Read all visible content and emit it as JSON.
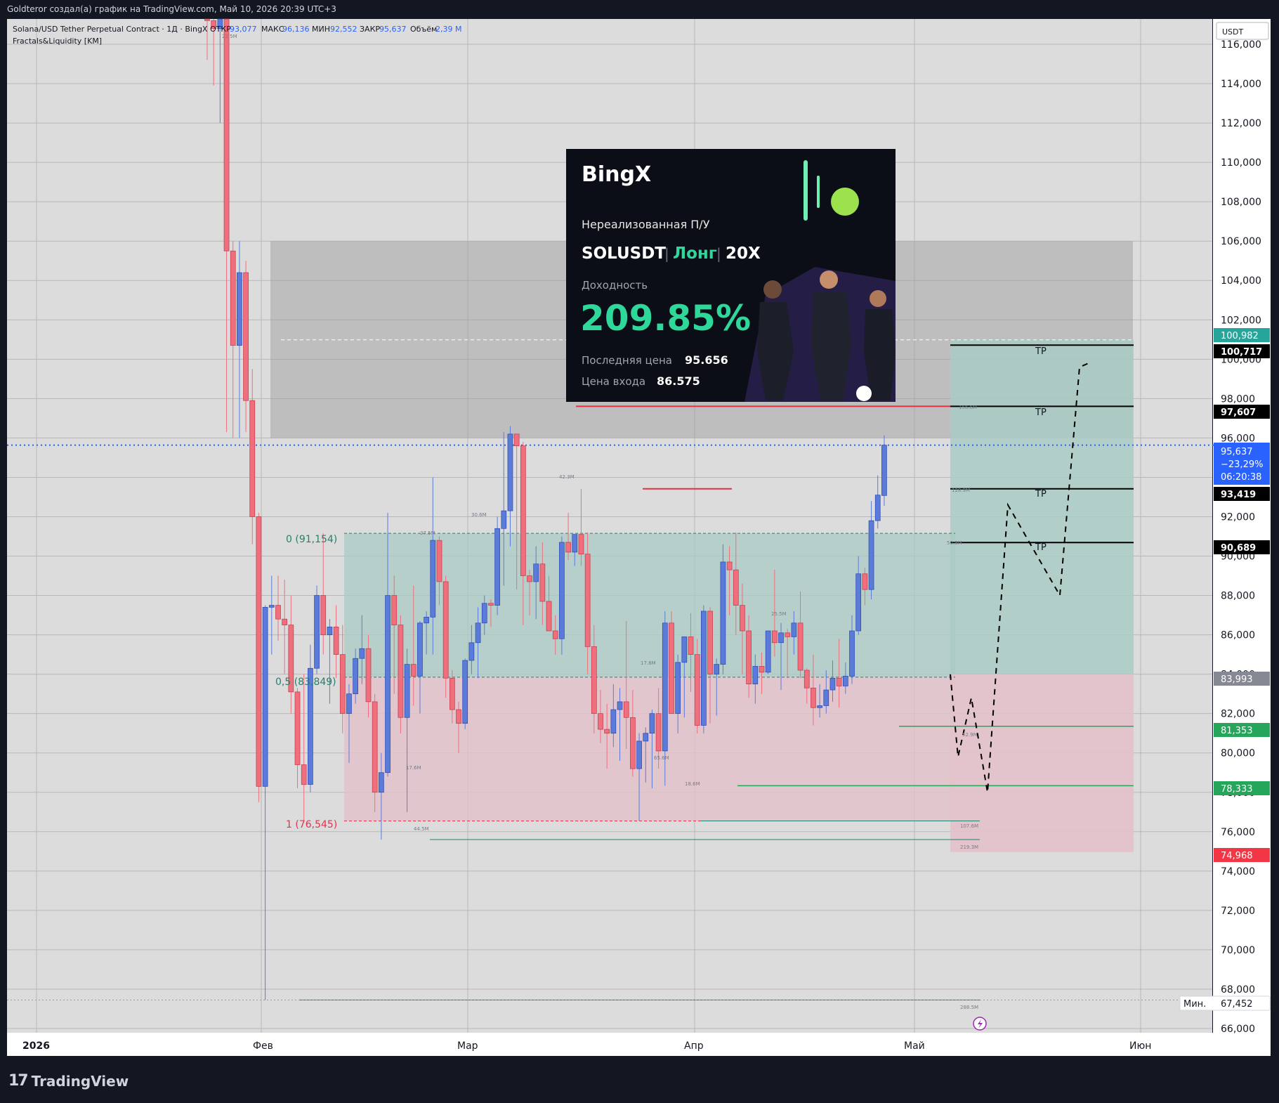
{
  "header_credit": "Goldteror создал(а) график на TradingView.com, Май 10, 2026 20:39 UTC+3",
  "brand": "TradingView",
  "legend": {
    "symbol": "Solana/USD Tether Perpetual Contract · 1Д · BingX",
    "open_label": "ОТКР",
    "open_value": "93,077",
    "high_label": "МАКС",
    "high_value": "96,136",
    "low_label": "МИН",
    "low_value": "92,552",
    "close_label": "ЗАКР",
    "close_value": "95,637",
    "volume_label": "Объём",
    "volume_value": "2,39 M",
    "indicator": "Fractals&Liquidity [KM]"
  },
  "currency": "USDT",
  "time_labels": {
    "year": "2026",
    "feb": "Фев",
    "mar": "Мар",
    "apr": "Апр",
    "may": "Май",
    "jun": "Июн"
  },
  "price_labels": {
    "p1": "100,982",
    "p2": "100,717",
    "p3": "97,607",
    "p4_price": "95,637",
    "p4_change": "−23,29%",
    "p4_timer": "06:20:38",
    "p5": "93,419",
    "p6": "90,689",
    "p7": "83,993",
    "p8": "81,353",
    "p9": "78,333",
    "p10": "74,968",
    "min_label": "Мин.",
    "min_value": "67,452"
  },
  "fib": {
    "level0": "0 (91,154)",
    "level05": "0,5 (83,849)",
    "level1": "1 (76,545)"
  },
  "tp_label": "TP",
  "volume_tags": [
    "22.5M",
    "156.6M",
    "128.9M",
    "50.9M",
    "42.3M",
    "30.6M",
    "37.5M",
    "25.5M",
    "17.8M",
    "17.6M",
    "65.6M",
    "18.6M",
    "44.5M",
    "107.6M",
    "219.3M",
    "288.5M",
    "52.9M"
  ],
  "promo": {
    "brand": "BingX",
    "subtitle": "Нереализованная П/У",
    "pair": "SOLUSDT",
    "side": "Лонг",
    "leverage": "20X",
    "yield_label": "Доходность",
    "yield_value": "209.85%",
    "last_label": "Последняя цена",
    "last_value": "95.656",
    "entry_label": "Цена входа",
    "entry_value": "86.575"
  },
  "colors": {
    "up": "#5b7bd8",
    "down": "#ef6f7c",
    "bg": "#dcdcdc",
    "accent": "#2962ff",
    "tp_zone": "#a9cbc4",
    "sl_zone": "#e3c1ca"
  },
  "chart_data": {
    "type": "candlestick",
    "ylim": [
      66000,
      117000
    ],
    "y_ticks": [
      66000,
      68000,
      70000,
      72000,
      74000,
      76000,
      78000,
      80000,
      82000,
      84000,
      86000,
      88000,
      90000,
      92000,
      94000,
      96000,
      98000,
      100000,
      102000,
      104000,
      106000,
      108000,
      110000,
      112000,
      114000,
      116000
    ],
    "y_tick_labels": [
      "66,000",
      "68,000",
      "70,000",
      "72,000",
      "74,000",
      "76,000",
      "78,000",
      "80,000",
      "82,000",
      "84,000",
      "86,000",
      "88,000",
      "90,000",
      "92,000",
      "94,000",
      "96,000",
      "98,000",
      "100,000",
      "102,000",
      "104,000",
      "106,000",
      "108,000",
      "110,000",
      "112,000",
      "114,000",
      "116,000"
    ],
    "x_start": "2026-01-27",
    "candles": [
      {
        "o": 117500,
        "h": 118500,
        "l": 115200,
        "c": 117200
      },
      {
        "o": 117200,
        "h": 118000,
        "l": 113900,
        "c": 116800
      },
      {
        "o": 116800,
        "h": 118200,
        "l": 112000,
        "c": 117500
      },
      {
        "o": 117500,
        "h": 117800,
        "l": 96300,
        "c": 105500
      },
      {
        "o": 105500,
        "h": 106000,
        "l": 96000,
        "c": 100700
      },
      {
        "o": 100700,
        "h": 106000,
        "l": 96000,
        "c": 104400
      },
      {
        "o": 104400,
        "h": 105000,
        "l": 96300,
        "c": 97900
      },
      {
        "o": 97900,
        "h": 99500,
        "l": 90600,
        "c": 92000
      },
      {
        "o": 92000,
        "h": 92200,
        "l": 77500,
        "c": 78300
      },
      {
        "o": 78300,
        "h": 87500,
        "l": 67452,
        "c": 87400
      },
      {
        "o": 87400,
        "h": 89000,
        "l": 85000,
        "c": 87500
      },
      {
        "o": 87500,
        "h": 89000,
        "l": 85700,
        "c": 86800
      },
      {
        "o": 86800,
        "h": 88800,
        "l": 84000,
        "c": 86500
      },
      {
        "o": 86500,
        "h": 88000,
        "l": 82000,
        "c": 83100
      },
      {
        "o": 83100,
        "h": 83300,
        "l": 78200,
        "c": 79400
      },
      {
        "o": 79400,
        "h": 84000,
        "l": 76545,
        "c": 78400
      },
      {
        "o": 78400,
        "h": 85500,
        "l": 78000,
        "c": 84300
      },
      {
        "o": 84300,
        "h": 88500,
        "l": 84000,
        "c": 88000
      },
      {
        "o": 88000,
        "h": 91154,
        "l": 85000,
        "c": 86000
      },
      {
        "o": 86000,
        "h": 86800,
        "l": 82500,
        "c": 86400
      },
      {
        "o": 86400,
        "h": 87500,
        "l": 83800,
        "c": 85000
      },
      {
        "o": 85000,
        "h": 86500,
        "l": 81000,
        "c": 82000
      },
      {
        "o": 82000,
        "h": 83500,
        "l": 79500,
        "c": 83000
      },
      {
        "o": 83000,
        "h": 85300,
        "l": 82500,
        "c": 84800
      },
      {
        "o": 84800,
        "h": 87000,
        "l": 83500,
        "c": 85300
      },
      {
        "o": 85300,
        "h": 86000,
        "l": 81800,
        "c": 82600
      },
      {
        "o": 82600,
        "h": 83000,
        "l": 77000,
        "c": 78000
      },
      {
        "o": 78000,
        "h": 80000,
        "l": 75600,
        "c": 79000
      },
      {
        "o": 79000,
        "h": 92200,
        "l": 78800,
        "c": 88000
      },
      {
        "o": 88000,
        "h": 89000,
        "l": 83000,
        "c": 86500
      },
      {
        "o": 86500,
        "h": 87000,
        "l": 81000,
        "c": 81800
      },
      {
        "o": 81800,
        "h": 85300,
        "l": 77000,
        "c": 84500
      },
      {
        "o": 84500,
        "h": 88500,
        "l": 82400,
        "c": 83900
      },
      {
        "o": 83900,
        "h": 86700,
        "l": 82000,
        "c": 86600
      },
      {
        "o": 86600,
        "h": 87200,
        "l": 85000,
        "c": 86900
      },
      {
        "o": 86900,
        "h": 94000,
        "l": 85000,
        "c": 90800
      },
      {
        "o": 90800,
        "h": 91000,
        "l": 87500,
        "c": 88700
      },
      {
        "o": 88700,
        "h": 89000,
        "l": 82800,
        "c": 83800
      },
      {
        "o": 83800,
        "h": 84200,
        "l": 81500,
        "c": 82200
      },
      {
        "o": 82200,
        "h": 82600,
        "l": 80000,
        "c": 81500
      },
      {
        "o": 81500,
        "h": 84800,
        "l": 81200,
        "c": 84700
      },
      {
        "o": 84700,
        "h": 86500,
        "l": 84000,
        "c": 85600
      },
      {
        "o": 85600,
        "h": 87400,
        "l": 83800,
        "c": 86600
      },
      {
        "o": 86600,
        "h": 88000,
        "l": 86000,
        "c": 87600
      },
      {
        "o": 87600,
        "h": 87800,
        "l": 86400,
        "c": 87500
      },
      {
        "o": 87500,
        "h": 92000,
        "l": 87000,
        "c": 91400
      },
      {
        "o": 91400,
        "h": 96300,
        "l": 88500,
        "c": 92300
      },
      {
        "o": 92300,
        "h": 96600,
        "l": 90500,
        "c": 96200
      },
      {
        "o": 96200,
        "h": 95900,
        "l": 88300,
        "c": 95600
      },
      {
        "o": 95600,
        "h": 95800,
        "l": 86500,
        "c": 89000
      },
      {
        "o": 89000,
        "h": 89300,
        "l": 87000,
        "c": 88700
      },
      {
        "o": 88700,
        "h": 90500,
        "l": 86800,
        "c": 89600
      },
      {
        "o": 89600,
        "h": 90700,
        "l": 86500,
        "c": 87700
      },
      {
        "o": 87700,
        "h": 89000,
        "l": 87200,
        "c": 86200
      },
      {
        "o": 86200,
        "h": 87000,
        "l": 85000,
        "c": 85800
      },
      {
        "o": 85800,
        "h": 91000,
        "l": 85000,
        "c": 90700
      },
      {
        "o": 90700,
        "h": 92200,
        "l": 89800,
        "c": 90200
      },
      {
        "o": 90200,
        "h": 91000,
        "l": 89500,
        "c": 91100
      },
      {
        "o": 91100,
        "h": 93400,
        "l": 89500,
        "c": 90100
      },
      {
        "o": 90100,
        "h": 91200,
        "l": 84000,
        "c": 85400
      },
      {
        "o": 85400,
        "h": 86500,
        "l": 81000,
        "c": 82000
      },
      {
        "o": 82000,
        "h": 83200,
        "l": 80500,
        "c": 81200
      },
      {
        "o": 81200,
        "h": 82500,
        "l": 79200,
        "c": 81000
      },
      {
        "o": 81000,
        "h": 83500,
        "l": 80300,
        "c": 82200
      },
      {
        "o": 82200,
        "h": 83300,
        "l": 79600,
        "c": 82600
      },
      {
        "o": 82600,
        "h": 86700,
        "l": 80200,
        "c": 81800
      },
      {
        "o": 81800,
        "h": 83200,
        "l": 78800,
        "c": 79200
      },
      {
        "o": 79200,
        "h": 81000,
        "l": 76545,
        "c": 80600
      },
      {
        "o": 80600,
        "h": 81300,
        "l": 78500,
        "c": 81000
      },
      {
        "o": 81000,
        "h": 82200,
        "l": 78200,
        "c": 82000
      },
      {
        "o": 82000,
        "h": 83300,
        "l": 79200,
        "c": 80100
      },
      {
        "o": 80100,
        "h": 87200,
        "l": 78333,
        "c": 86600
      },
      {
        "o": 86600,
        "h": 87200,
        "l": 82500,
        "c": 82000
      },
      {
        "o": 82000,
        "h": 85000,
        "l": 81000,
        "c": 84600
      },
      {
        "o": 84600,
        "h": 85000,
        "l": 81800,
        "c": 85900
      },
      {
        "o": 85900,
        "h": 87100,
        "l": 83100,
        "c": 85000
      },
      {
        "o": 85000,
        "h": 85800,
        "l": 81000,
        "c": 81400
      },
      {
        "o": 81400,
        "h": 87500,
        "l": 81000,
        "c": 87200
      },
      {
        "o": 87200,
        "h": 87400,
        "l": 81500,
        "c": 84000
      },
      {
        "o": 84000,
        "h": 84800,
        "l": 81900,
        "c": 84500
      },
      {
        "o": 84500,
        "h": 90600,
        "l": 84000,
        "c": 89700
      },
      {
        "o": 89700,
        "h": 90500,
        "l": 87000,
        "c": 89300
      },
      {
        "o": 89300,
        "h": 91200,
        "l": 86000,
        "c": 87500
      },
      {
        "o": 87500,
        "h": 88600,
        "l": 84000,
        "c": 86200
      },
      {
        "o": 86200,
        "h": 87000,
        "l": 82800,
        "c": 83500
      },
      {
        "o": 83500,
        "h": 85000,
        "l": 82500,
        "c": 84400
      },
      {
        "o": 84400,
        "h": 85100,
        "l": 83000,
        "c": 84100
      },
      {
        "o": 84100,
        "h": 86200,
        "l": 84000,
        "c": 86200
      },
      {
        "o": 86200,
        "h": 89300,
        "l": 84900,
        "c": 85600
      },
      {
        "o": 85600,
        "h": 86600,
        "l": 83200,
        "c": 86100
      },
      {
        "o": 86100,
        "h": 86300,
        "l": 83800,
        "c": 85900
      },
      {
        "o": 85900,
        "h": 87200,
        "l": 85000,
        "c": 86600
      },
      {
        "o": 86600,
        "h": 88200,
        "l": 83800,
        "c": 84200
      },
      {
        "o": 84200,
        "h": 84300,
        "l": 82500,
        "c": 83300
      },
      {
        "o": 83300,
        "h": 85000,
        "l": 81400,
        "c": 82300
      },
      {
        "o": 82300,
        "h": 83500,
        "l": 81800,
        "c": 82400
      },
      {
        "o": 82400,
        "h": 84200,
        "l": 82000,
        "c": 83200
      },
      {
        "o": 83200,
        "h": 84700,
        "l": 82600,
        "c": 83800
      },
      {
        "o": 83800,
        "h": 85800,
        "l": 82300,
        "c": 83400
      },
      {
        "o": 83400,
        "h": 84600,
        "l": 83000,
        "c": 83900
      },
      {
        "o": 83900,
        "h": 87000,
        "l": 83500,
        "c": 86200
      },
      {
        "o": 86200,
        "h": 90000,
        "l": 86000,
        "c": 89100
      },
      {
        "o": 89100,
        "h": 89400,
        "l": 87500,
        "c": 88300
      },
      {
        "o": 88300,
        "h": 92800,
        "l": 87800,
        "c": 91800
      },
      {
        "o": 91800,
        "h": 94100,
        "l": 91400,
        "c": 93100
      },
      {
        "o": 93077,
        "h": 96136,
        "l": 92552,
        "c": 95637
      }
    ],
    "fib_levels": [
      {
        "ratio": "0",
        "value": 91154
      },
      {
        "ratio": "0.5",
        "value": 83849
      },
      {
        "ratio": "1",
        "value": 76545
      }
    ],
    "price_levels": [
      100982,
      100717,
      97607,
      93419,
      90689,
      83993,
      81353,
      78333,
      74968,
      67452
    ],
    "take_profits": [
      100717,
      97607,
      93419,
      90689
    ],
    "last_price": 95637,
    "change_pct": -23.29
  }
}
